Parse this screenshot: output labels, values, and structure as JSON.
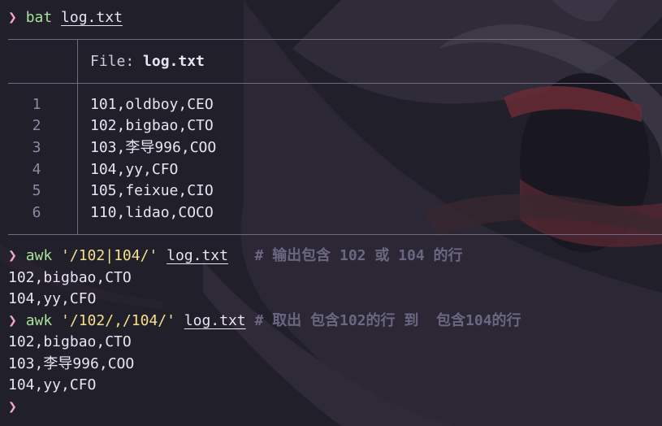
{
  "prompt_symbol": "❯",
  "cmd1": {
    "program": "bat",
    "arg": "log.txt"
  },
  "bat": {
    "header_label": "File: ",
    "header_file": "log.txt",
    "lines": [
      {
        "num": "1",
        "text": "101,oldboy,CEO"
      },
      {
        "num": "2",
        "text": "102,bigbao,CTO"
      },
      {
        "num": "3",
        "text": "103,李导996,COO"
      },
      {
        "num": "4",
        "text": "104,yy,CFO"
      },
      {
        "num": "5",
        "text": "105,feixue,CIO"
      },
      {
        "num": "6",
        "text": "110,lidao,COCO"
      }
    ]
  },
  "cmd2": {
    "program": "awk",
    "pattern": "'/102|104/'",
    "file": "log.txt",
    "comment": "# 输出包含 102 或 104 的行"
  },
  "output2": [
    "102,bigbao,CTO",
    "104,yy,CFO"
  ],
  "cmd3": {
    "program": "awk",
    "pattern": "'/102/,/104/'",
    "file": "log.txt",
    "comment": "# 取出 包含102的行 到  包含104的行"
  },
  "output3": [
    "102,bigbao,CTO",
    "103,李导996,COO",
    "104,yy,CFO"
  ],
  "colors": {
    "background": "#22202b",
    "prompt": "#f2a7c6",
    "command": "#a6e39a",
    "string": "#f5e08c",
    "comment": "#6b6782"
  }
}
